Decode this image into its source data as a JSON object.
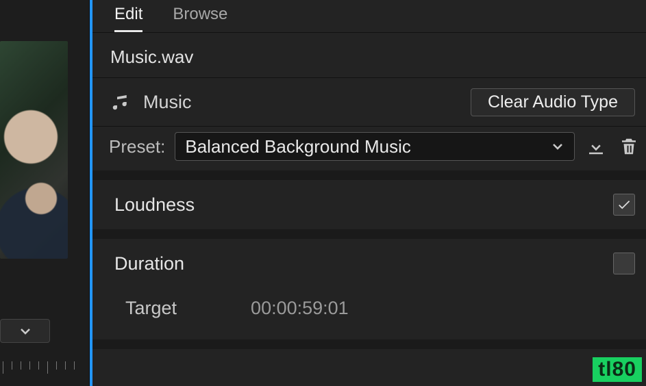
{
  "tabs": {
    "edit": "Edit",
    "browse": "Browse"
  },
  "filename": "Music.wav",
  "audio_type": {
    "label": "Music",
    "clear_label": "Clear Audio Type"
  },
  "preset": {
    "label": "Preset:",
    "value": "Balanced Background Music"
  },
  "sections": {
    "loudness": {
      "title": "Loudness",
      "enabled": true
    },
    "duration": {
      "title": "Duration",
      "enabled": false,
      "target_label": "Target",
      "target_value": "00:00:59:01"
    }
  },
  "watermark": "tl80"
}
